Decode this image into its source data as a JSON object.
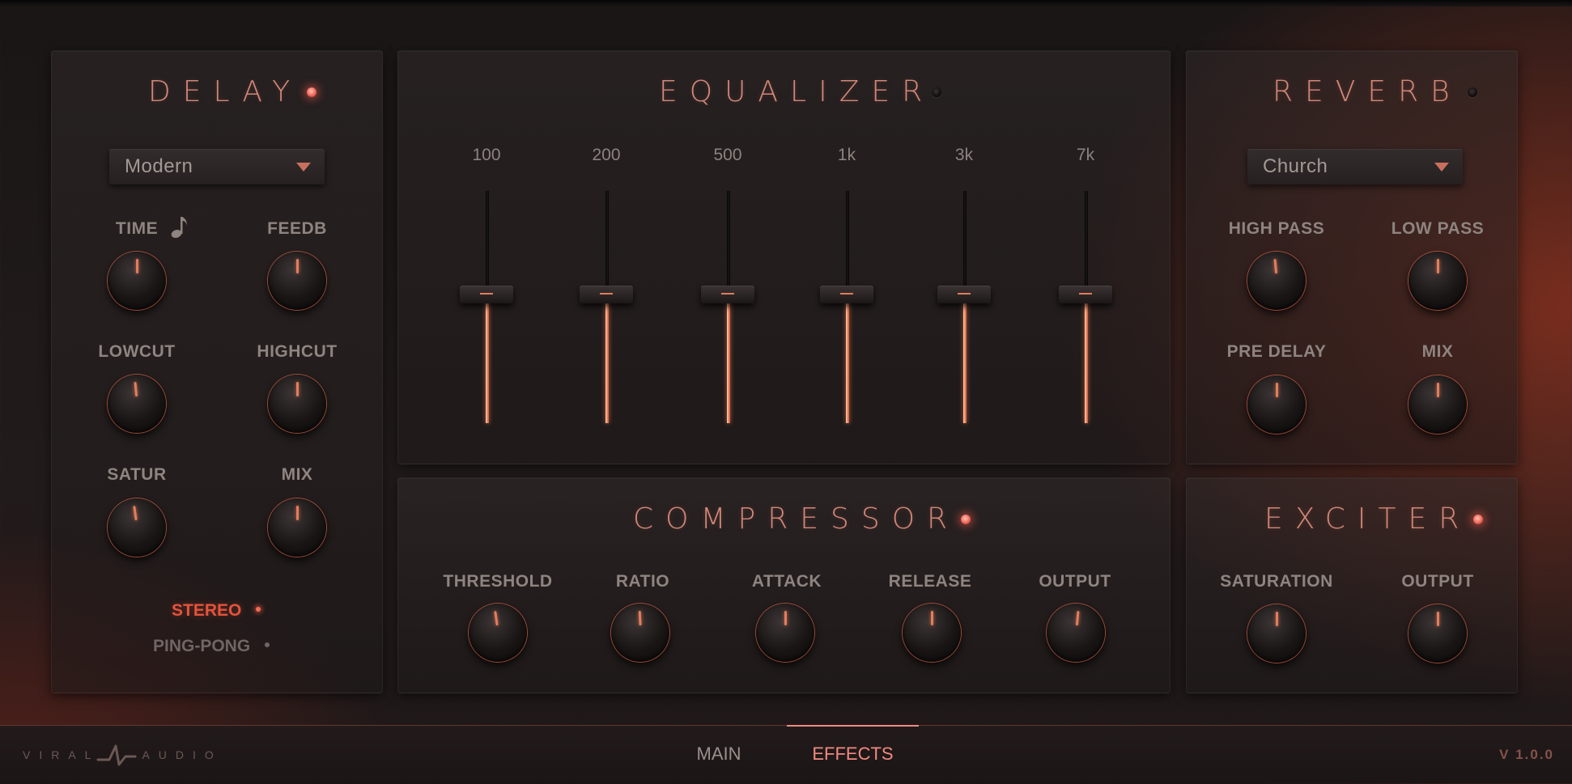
{
  "delay": {
    "title": "DELAY",
    "enabled": true,
    "preset": "Modern",
    "knobs": [
      {
        "label": "TIME",
        "value": 0.5
      },
      {
        "label": "FEEDB",
        "value": 0.5
      },
      {
        "label": "LOWCUT",
        "value": 0.48
      },
      {
        "label": "HIGHCUT",
        "value": 0.5
      },
      {
        "label": "SATUR",
        "value": 0.47
      },
      {
        "label": "MIX",
        "value": 0.5
      }
    ],
    "modes": {
      "stereo": "STEREO",
      "pingpong": "PING-PONG",
      "selected": "STEREO"
    }
  },
  "equalizer": {
    "title": "EQUALIZER",
    "enabled": false,
    "bands": [
      {
        "label": "100",
        "value": 0.5
      },
      {
        "label": "200",
        "value": 0.5
      },
      {
        "label": "500",
        "value": 0.5
      },
      {
        "label": "1k",
        "value": 0.5
      },
      {
        "label": "3k",
        "value": 0.5
      },
      {
        "label": "7k",
        "value": 0.5
      }
    ]
  },
  "reverb": {
    "title": "REVERB",
    "enabled": false,
    "preset": "Church",
    "knobs": [
      {
        "label": "HIGH PASS",
        "value": 0.48
      },
      {
        "label": "LOW PASS",
        "value": 0.5
      },
      {
        "label": "PRE DELAY",
        "value": 0.5
      },
      {
        "label": "MIX",
        "value": 0.5
      }
    ]
  },
  "compressor": {
    "title": "COMPRESSOR",
    "enabled": true,
    "knobs": [
      {
        "label": "THRESHOLD",
        "value": 0.47
      },
      {
        "label": "RATIO",
        "value": 0.49
      },
      {
        "label": "ATTACK",
        "value": 0.5
      },
      {
        "label": "RELEASE",
        "value": 0.5
      },
      {
        "label": "OUTPUT",
        "value": 0.52
      }
    ]
  },
  "exciter": {
    "title": "EXCITER",
    "enabled": true,
    "knobs": [
      {
        "label": "SATURATION",
        "value": 0.5
      },
      {
        "label": "OUTPUT",
        "value": 0.5
      }
    ]
  },
  "footer": {
    "logo_left": "VIRAL",
    "logo_right": "AUDIO",
    "tabs": [
      {
        "label": "MAIN",
        "active": false
      },
      {
        "label": "EFFECTS",
        "active": true
      }
    ],
    "version": "V 1.0.0"
  },
  "colors": {
    "accent": "#e07b5c",
    "led_on": "#f0685a",
    "title": "#d2887a",
    "active_tab": "#f08a82",
    "stereo_active": "#e3533b"
  },
  "icons": {
    "time_sync": "music-note-icon",
    "dropdown": "triangle-down-icon"
  }
}
